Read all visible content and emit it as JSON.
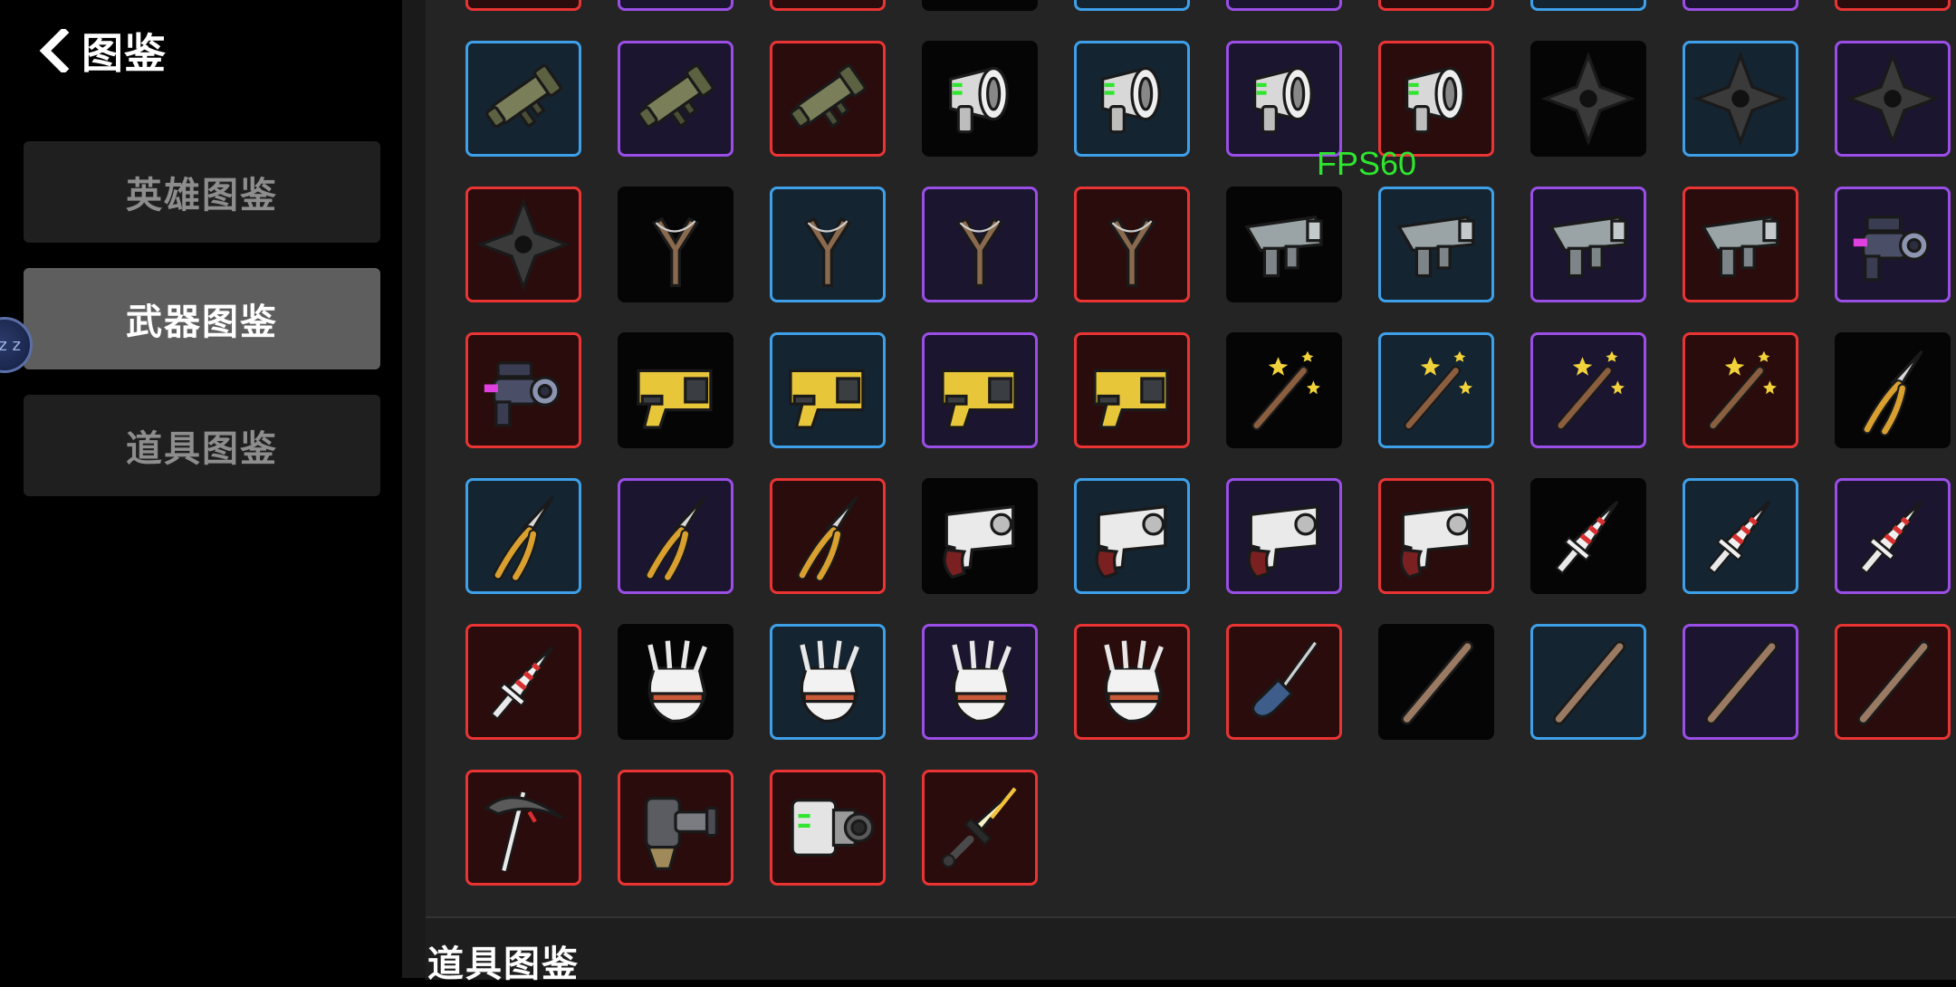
{
  "header": {
    "title": "图鉴"
  },
  "nav": {
    "items": [
      {
        "label": "英雄图鉴",
        "active": false
      },
      {
        "label": "武器图鉴",
        "active": true
      },
      {
        "label": "道具图鉴",
        "active": false
      }
    ]
  },
  "overlay": {
    "fps_label": "FPS60",
    "float_ball_text": "z z"
  },
  "colors": {
    "white": "#050505",
    "blue": "#3ea0e8",
    "purple": "#9a4ee6",
    "red": "#ea3434"
  },
  "weapons": {
    "rows": [
      [
        "turret-icon:red",
        "claw-hook-icon:purple",
        "claw-hook-icon:red",
        "drill-icon:white",
        "chain-blaster-icon:blue",
        "chain-blaster-icon:purple",
        "drill-icon:red",
        "chain-blaster-icon:blue",
        "chain-blaster-icon:purple",
        "chain-blaster-icon:red"
      ],
      [
        "bazooka-icon:blue",
        "bazooka-icon:purple",
        "bazooka-icon:red",
        "megaphone-gun-icon:white",
        "megaphone-gun-icon:blue",
        "megaphone-gun-icon:purple",
        "megaphone-gun-icon:red",
        "shuriken-icon:white",
        "shuriken-icon:blue",
        "shuriken-icon:purple"
      ],
      [
        "shuriken-icon:red",
        "slingshot-icon:white",
        "slingshot-icon:blue",
        "slingshot-icon:purple",
        "slingshot-icon:red",
        "smg-icon:white",
        "smg-icon:blue",
        "smg-icon:purple",
        "smg-icon:red",
        "raygun-icon:purple"
      ],
      [
        "raygun-icon:red",
        "taser-icon:white",
        "taser-icon:blue",
        "taser-icon:purple",
        "taser-icon:red",
        "magic-wand-icon:white",
        "magic-wand-icon:blue",
        "magic-wand-icon:purple",
        "magic-wand-icon:red",
        "pruning-shears-icon:white"
      ],
      [
        "pruning-shears-icon:blue",
        "pruning-shears-icon:purple",
        "pruning-shears-icon:red",
        "glue-gun-icon:white",
        "glue-gun-icon:blue",
        "glue-gun-icon:purple",
        "glue-gun-icon:red",
        "lance-icon:white",
        "lance-icon:blue",
        "lance-icon:purple"
      ],
      [
        "lance-icon:red",
        "claw-glove-icon:white",
        "claw-glove-icon:blue",
        "claw-glove-icon:purple",
        "claw-glove-icon:red",
        "screwdriver-icon:red",
        "baton-icon:white",
        "baton-icon:blue",
        "baton-icon:purple",
        "baton-icon:red"
      ],
      [
        "scythe-icon:red",
        "cannon-icon:red",
        "camera-gun-icon:red",
        "golden-sword-icon:red"
      ]
    ]
  },
  "section": {
    "title": "道具图鉴"
  }
}
